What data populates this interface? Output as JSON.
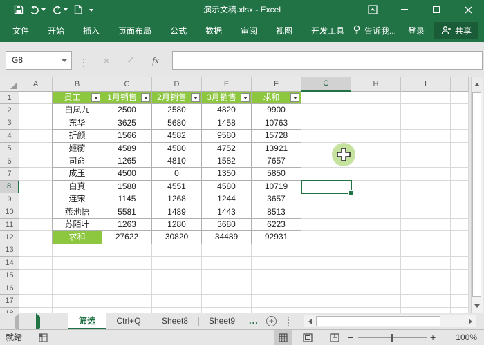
{
  "window": {
    "title": "演示文稿.xlsx - Excel",
    "quick_access_icons": [
      "save-icon",
      "undo-icon",
      "redo-icon",
      "new-document-icon",
      "customize-quick-access-icon"
    ],
    "control_icons": [
      "ribbon-display-options-icon",
      "minimize-icon",
      "maximize-icon",
      "close-icon"
    ]
  },
  "ribbon": {
    "tabs": [
      "文件",
      "开始",
      "插入",
      "页面布局",
      "公式",
      "数据",
      "审阅",
      "视图",
      "开发工具"
    ],
    "tell_me": "告诉我...",
    "sign_in": "登录",
    "share": "共享"
  },
  "formula_bar": {
    "name_box": "G8",
    "cancel": "×",
    "enter": "✓",
    "fx_label": "fx"
  },
  "sheet": {
    "columns": [
      "A",
      "B",
      "C",
      "D",
      "E",
      "F",
      "G",
      "H",
      "I"
    ],
    "visible_rows": 18,
    "selected_cell": "G8",
    "selected_column": "G",
    "selected_row": 8,
    "table": {
      "headers": [
        "员工",
        "1月销售",
        "2月销售",
        "3月销售",
        "求和"
      ],
      "rows": [
        [
          "白凤九",
          2500,
          2580,
          4820,
          9900
        ],
        [
          "东华",
          3625,
          5680,
          1458,
          10763
        ],
        [
          "折颜",
          1566,
          4582,
          9580,
          15728
        ],
        [
          "姬蘅",
          4589,
          4580,
          4752,
          13921
        ],
        [
          "司命",
          1265,
          4810,
          1582,
          7657
        ],
        [
          "成玉",
          4500,
          0,
          1350,
          5850
        ],
        [
          "白真",
          1588,
          4551,
          4580,
          10719
        ],
        [
          "连宋",
          1145,
          1268,
          1244,
          3657
        ],
        [
          "燕池悟",
          5581,
          1489,
          1443,
          8513
        ],
        [
          "苏陌叶",
          1263,
          1280,
          3680,
          6223
        ]
      ],
      "total_row": [
        "求和",
        27622,
        30820,
        34489,
        92931
      ]
    }
  },
  "sheet_tabs": {
    "tabs": [
      {
        "label": "筛选",
        "active": true
      },
      {
        "label": "Ctrl+Q",
        "active": false
      },
      {
        "label": "Sheet8",
        "active": false
      },
      {
        "label": "Sheet9",
        "active": false
      }
    ],
    "overflow": "...",
    "add_label": "+"
  },
  "status_bar": {
    "ready": "就绪",
    "zoom_out": "−",
    "zoom_in": "+",
    "zoom_level": "100%",
    "view_icons": [
      "normal-view-icon",
      "page-layout-view-icon",
      "page-break-preview-icon"
    ]
  },
  "colors": {
    "excel_green": "#217346",
    "table_header_green": "#8dc63f",
    "selection_border": "#217346",
    "share_button_bg": "#1a5c38"
  }
}
